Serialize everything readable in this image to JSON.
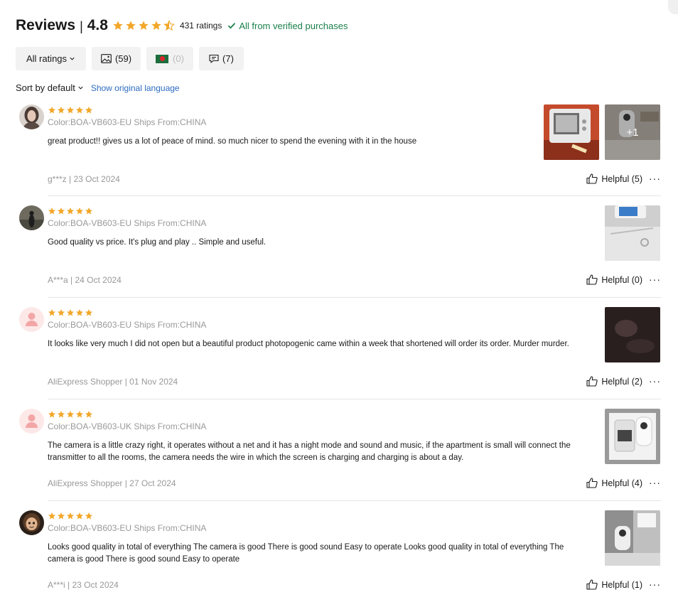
{
  "header": {
    "title": "Reviews",
    "separator": "|",
    "score": "4.8",
    "rating_value": 4.5,
    "ratings_count": "431 ratings",
    "verified": "All from verified purchases",
    "colors": {
      "star": "#f2a72a",
      "verified": "#1a7f4b",
      "link": "#2d6cc0"
    }
  },
  "filters": {
    "all_label": "All ratings",
    "photos_count": "(59)",
    "local_count": "(0)",
    "text_count": "(7)"
  },
  "sort": {
    "label": "Sort by default",
    "original_language": "Show original language"
  },
  "reviews": [
    {
      "stars": 5,
      "variant": "Color:BOA-VB603-EU Ships From:CHINA",
      "text": "great product!! gives us a lot of peace of mind. so much nicer to spend the evening with it in the house",
      "meta": "g***z | 23 Oct 2024",
      "helpful": "Helpful (5)",
      "extra_photos": "+1"
    },
    {
      "stars": 5,
      "variant": "Color:BOA-VB603-EU Ships From:CHINA",
      "text": "Good quality vs price. It's plug and play .. Simple and useful.",
      "meta": "A***a | 24 Oct 2024",
      "helpful": "Helpful (0)"
    },
    {
      "stars": 5,
      "variant": "Color:BOA-VB603-EU Ships From:CHINA",
      "text": "It looks like very much I did not open but a beautiful product photopogenic came within a week that shortened will order its order. Murder murder.",
      "meta": "AliExpress Shopper | 01 Nov 2024",
      "helpful": "Helpful (2)"
    },
    {
      "stars": 5,
      "variant": "Color:BOA-VB603-UK Ships From:CHINA",
      "text": "The camera is a little crazy right, it operates without a net and it has a night mode and sound and music, if the apartment is small will connect the transmitter to all the rooms, the camera needs the wire in which the screen is charging and charging is about a day.",
      "meta": "AliExpress Shopper | 27 Oct 2024",
      "helpful": "Helpful (4)"
    },
    {
      "stars": 5,
      "variant": "Color:BOA-VB603-EU Ships From:CHINA",
      "text": "Looks good quality in total of everything The camera is good There is good sound Easy to operate Looks good quality in total of everything The camera is good There is good sound Easy to operate",
      "meta": "A***i | 23 Oct 2024",
      "helpful": "Helpful (1)"
    }
  ],
  "more_label": "···"
}
